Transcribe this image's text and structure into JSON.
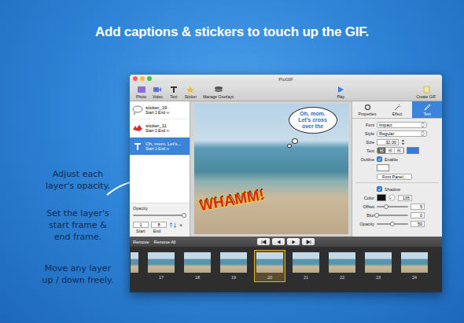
{
  "headline": "Add captions & stickers to touch up the GIF.",
  "annotations": [
    [
      "Adjust each",
      "layer's opacity."
    ],
    [
      "Set the layer's",
      "start frame &",
      "end frame."
    ],
    [
      "Move any layer",
      "up / down freely."
    ]
  ],
  "window": {
    "title": "PicGIF"
  },
  "toolbar": {
    "left": [
      {
        "label": "Photo"
      },
      {
        "label": "Video"
      },
      {
        "label": "Text"
      },
      {
        "label": "Sticker"
      },
      {
        "label": "Manage Overlays"
      }
    ],
    "center": {
      "label": "Play"
    },
    "right": {
      "label": "Create GIF"
    }
  },
  "layers": [
    {
      "name": "sticker_19",
      "range": "Start 1 End ∞",
      "kind": "bubble",
      "selected": false
    },
    {
      "name": "sticker_11",
      "range": "Start 1 End ∞",
      "kind": "sticker",
      "selected": false
    },
    {
      "name": "Oh, mom. Let's...",
      "range": "Start 1 End ∞",
      "kind": "text",
      "selected": true
    }
  ],
  "layer_opacity": {
    "label": "Opacity",
    "level": 0.95
  },
  "frame_range": {
    "start": "1",
    "end": "8",
    "start_label": "Start",
    "end_label": "End",
    "clear": "×"
  },
  "canvas": {
    "caption": "Oh, mom. Let's cross over the",
    "sticker": "WHAMM!"
  },
  "inspector": {
    "tabs": [
      {
        "label": "Properties",
        "selected": false
      },
      {
        "label": "Effect",
        "selected": false
      },
      {
        "label": "Text",
        "selected": true
      }
    ],
    "font": {
      "label": "Font",
      "value": "Impact"
    },
    "style": {
      "label": "Style",
      "value": "Regular"
    },
    "size": {
      "label": "Size",
      "value": "32.00"
    },
    "text": {
      "label": "Text"
    },
    "outline": {
      "label": "Outline",
      "checkbox": "Enable",
      "checked": true
    },
    "font_panel": "Font Panel...",
    "shadow": {
      "label": "Shadow",
      "checked": true,
      "color_label": "Color",
      "color_reading": "135",
      "sliders": [
        {
          "label": "Offset",
          "value": "5",
          "level": 0.3
        },
        {
          "label": "Blur",
          "value": "0",
          "level": 0.0
        },
        {
          "label": "Opacity",
          "value": "50",
          "level": 0.5
        }
      ]
    }
  },
  "controls": {
    "remove": "Remove",
    "remove_all": "Remove All"
  },
  "frames": [
    {
      "label": "17",
      "selected": false
    },
    {
      "label": "18",
      "selected": false
    },
    {
      "label": "19",
      "selected": false
    },
    {
      "label": "20",
      "selected": true
    },
    {
      "label": "21",
      "selected": false
    },
    {
      "label": "22",
      "selected": false
    },
    {
      "label": "23",
      "selected": false
    },
    {
      "label": "24",
      "selected": false
    }
  ]
}
